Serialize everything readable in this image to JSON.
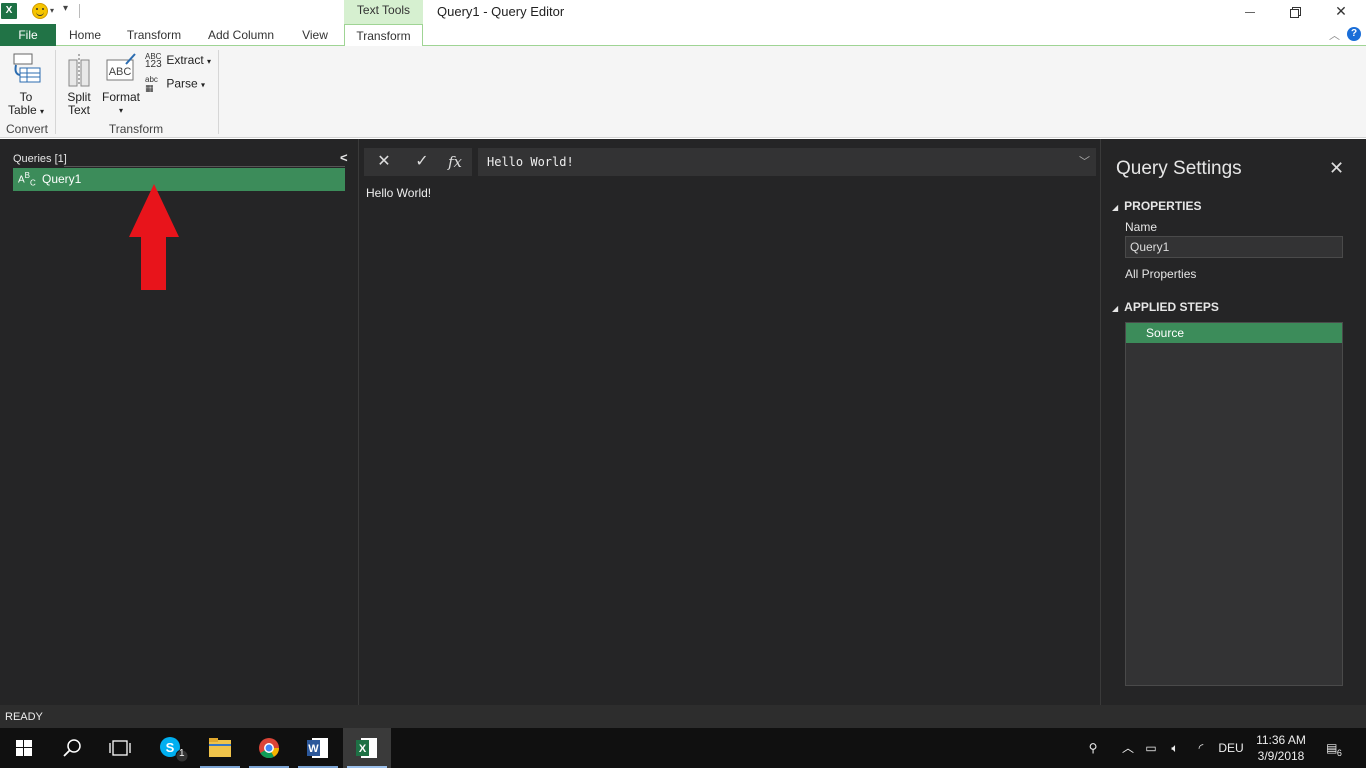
{
  "window": {
    "title": "Query1 - Query Editor",
    "context_tab_group": "Text Tools",
    "app_icon": "X"
  },
  "ribbon_tabs": {
    "file": "File",
    "home": "Home",
    "transform": "Transform",
    "add_column": "Add Column",
    "view": "View",
    "context_transform": "Transform"
  },
  "ribbon": {
    "to_table": {
      "line1": "To",
      "line2": "Table"
    },
    "split_text": {
      "line1": "Split",
      "line2": "Text"
    },
    "format": {
      "label": "Format",
      "icon_text": "ABC"
    },
    "extract": {
      "label": "Extract",
      "icon_line1": "ABC",
      "icon_line2": "123"
    },
    "parse": {
      "label": "Parse",
      "icon_text": "abc"
    },
    "groups": {
      "convert": "Convert",
      "transform": "Transform"
    }
  },
  "queries_pane": {
    "header": "Queries [1]",
    "items": [
      {
        "name": "Query1",
        "type_icon": "ABC"
      }
    ]
  },
  "formula_bar": {
    "formula": "Hello World!",
    "fx_label": "fx"
  },
  "result": {
    "value": "Hello World!"
  },
  "query_settings": {
    "title": "Query Settings",
    "properties_header": "PROPERTIES",
    "name_label": "Name",
    "name_value": "Query1",
    "all_properties": "All Properties",
    "applied_steps_header": "APPLIED STEPS",
    "steps": [
      "Source"
    ]
  },
  "status": {
    "text": "READY"
  },
  "taskbar": {
    "skype_badge": "1",
    "language": "DEU",
    "time": "11:36 AM",
    "date": "3/9/2018",
    "notification_count": "6"
  },
  "colors": {
    "excel_green": "#217346",
    "selection_green": "#3c8c5a",
    "dark_background": "#252526",
    "context_tab": "#d6f0d0",
    "annotation_arrow": "#e8141b"
  }
}
